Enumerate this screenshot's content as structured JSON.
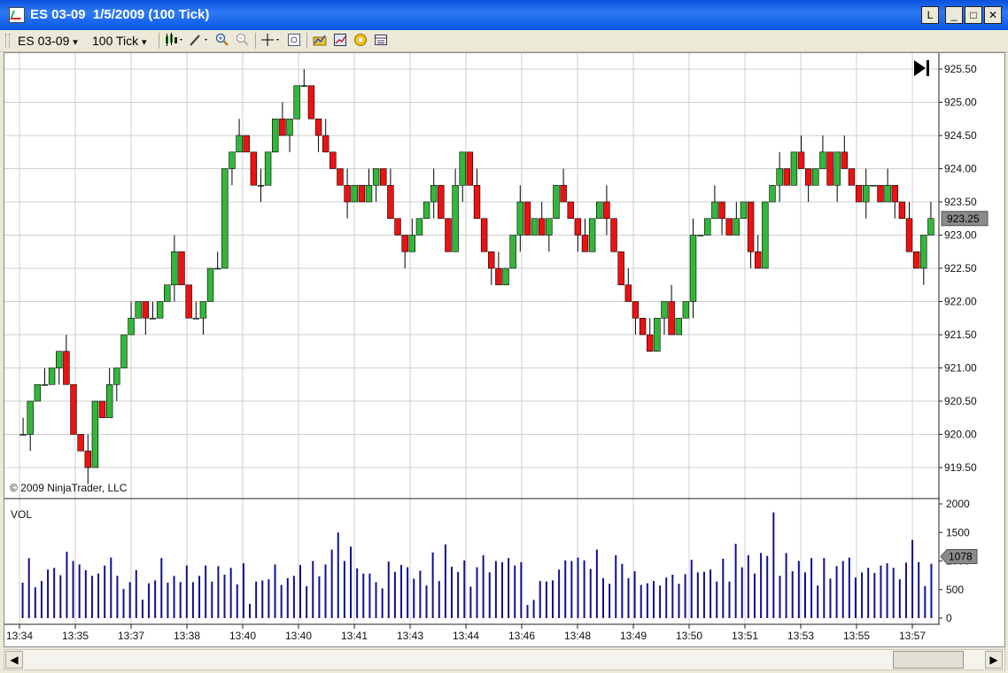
{
  "window": {
    "title": "ES 03-09  1/5/2009 (100 Tick)",
    "buttons": {
      "layout": "L",
      "minimize": "_",
      "maximize": "□",
      "close": "✕"
    }
  },
  "toolbar": {
    "instrument": "ES 03-09",
    "interval": "100 Tick",
    "dropdown_glyph": "▾"
  },
  "chart": {
    "copyright": "© 2009 NinjaTrader, LLC",
    "volume_label": "VOL"
  },
  "colors": {
    "up": "#33b73a",
    "down": "#ee1111",
    "volume": "#101090",
    "grid": "#cfcfcf"
  },
  "chart_data": [
    {
      "type": "candlestick",
      "title": "",
      "ylim": [
        919.25,
        925.75
      ],
      "ticks": [
        925.5,
        925.0,
        924.5,
        924.0,
        923.5,
        923.0,
        922.5,
        922.0,
        921.5,
        921.0,
        920.5,
        920.0,
        919.5
      ],
      "tick_labels": [
        "925.50",
        "925.00",
        "924.50",
        "924.00",
        "923.50",
        "923.00",
        "922.50",
        "922.00",
        "921.50",
        "921.00",
        "920.50",
        "920.00",
        "919.50"
      ],
      "last_price": "923.25",
      "close": [
        920.0,
        920.5,
        920.75,
        920.75,
        921.0,
        921.25,
        920.75,
        920.0,
        919.75,
        919.5,
        920.5,
        920.25,
        920.75,
        921.0,
        921.5,
        921.75,
        922.0,
        921.75,
        921.75,
        922.0,
        922.25,
        922.75,
        922.25,
        921.75,
        921.75,
        922.0,
        922.5,
        922.5,
        924.0,
        924.25,
        924.5,
        924.25,
        923.75,
        923.75,
        924.25,
        924.75,
        924.5,
        924.75,
        925.25,
        925.25,
        924.75,
        924.5,
        924.25,
        924.0,
        923.75,
        923.5,
        923.75,
        923.5,
        923.75,
        924.0,
        923.75,
        923.25,
        923.0,
        922.75,
        923.0,
        923.25,
        923.5,
        923.75,
        923.25,
        922.75,
        923.75,
        924.25,
        923.75,
        923.25,
        922.75,
        922.5,
        922.25,
        922.5,
        923.0,
        923.5,
        923.0,
        923.25,
        923.0,
        923.25,
        923.75,
        923.5,
        923.25,
        923.0,
        922.75,
        923.25,
        923.5,
        923.25,
        922.75,
        922.25,
        922.0,
        921.75,
        921.5,
        921.25,
        921.75,
        922.0,
        921.5,
        921.75,
        922.0,
        923.0,
        923.0,
        923.25,
        923.5,
        923.25,
        923.0,
        923.25,
        923.5,
        922.75,
        922.5,
        923.5,
        923.75,
        924.0,
        923.75,
        924.25,
        924.0,
        923.75,
        924.0,
        924.25,
        923.75,
        924.25,
        924.0,
        923.75,
        923.5,
        923.75,
        923.75,
        923.5,
        923.75,
        923.5,
        923.25,
        922.75,
        922.5,
        923.0,
        923.25
      ],
      "series": [
        {
          "name": "VOL",
          "values": []
        }
      ]
    },
    {
      "type": "bar",
      "title": "",
      "ylim": [
        0,
        2000
      ],
      "ticks": [
        2000,
        1500,
        1000,
        500,
        0
      ],
      "tick_labels": [
        "2000",
        "1500",
        "1000",
        "500",
        "0"
      ],
      "last_value": "1078",
      "values": [
        620,
        1050,
        540,
        650,
        850,
        880,
        750,
        1160,
        1000,
        940,
        840,
        740,
        780,
        920,
        1060,
        740,
        510,
        630,
        840,
        320,
        610,
        660,
        1050,
        620,
        740,
        630,
        920,
        630,
        740,
        920,
        640,
        910,
        760,
        880,
        590,
        960,
        250,
        640,
        660,
        680,
        940,
        580,
        700,
        740,
        930,
        560,
        1000,
        730,
        940,
        1200,
        1500,
        1000,
        1250,
        870,
        780,
        780,
        630,
        520,
        990,
        810,
        930,
        890,
        690,
        830,
        570,
        1150,
        650,
        1290,
        900,
        810,
        1010,
        550,
        890,
        1100,
        800,
        1000,
        980,
        1050,
        920,
        980,
        230,
        320,
        650,
        640,
        660,
        850,
        1010,
        1000,
        1060,
        1010,
        860,
        1200,
        700,
        600,
        1100,
        950,
        700,
        820,
        580,
        610,
        650,
        570,
        710,
        760,
        600,
        770,
        1020,
        800,
        810,
        850,
        640,
        1040,
        640,
        1300,
        890,
        1100,
        780,
        1140,
        1090,
        1850,
        740,
        1140,
        820,
        1000,
        800,
        1050,
        570,
        1050,
        690,
        910,
        1000,
        1060,
        710,
        800,
        880,
        790,
        920,
        960,
        880,
        680,
        970,
        1370,
        980,
        560,
        950
      ],
      "series": [
        {
          "name": "VOL",
          "values": []
        }
      ]
    }
  ],
  "x_axis": {
    "labels": [
      "13:34",
      "13:35",
      "13:37",
      "13:38",
      "13:40",
      "13:40",
      "13:41",
      "13:43",
      "13:44",
      "13:46",
      "13:48",
      "13:49",
      "13:50",
      "13:51",
      "13:53",
      "13:55",
      "13:57"
    ]
  }
}
